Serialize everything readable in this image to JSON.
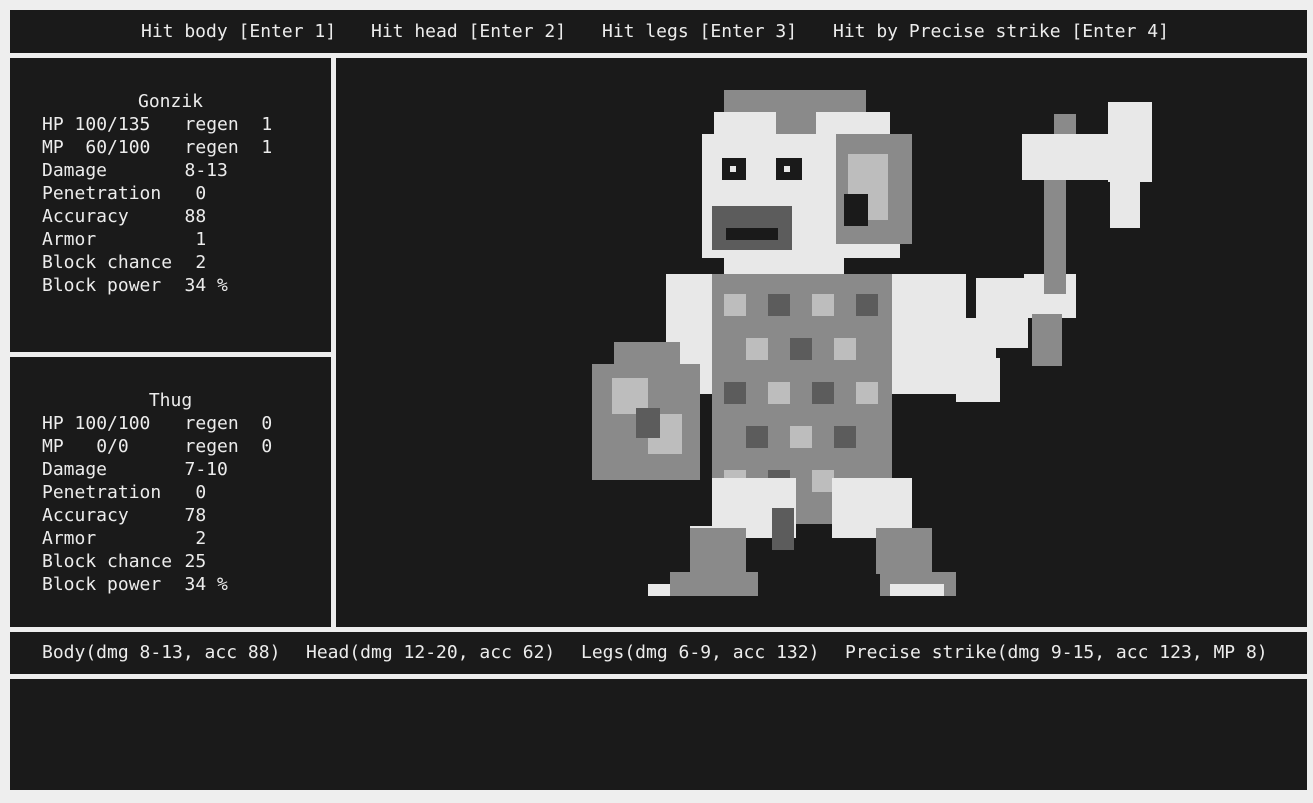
{
  "menu": {
    "items": [
      {
        "label": "Hit body [Enter 1]"
      },
      {
        "label": "Hit head [Enter 2]"
      },
      {
        "label": "Hit legs [Enter 3]"
      },
      {
        "label": "Hit by Precise strike [Enter 4]"
      }
    ]
  },
  "hero": {
    "name": "Gonzik",
    "hp_label": "HP",
    "hp": "100/135",
    "hp_regen_label": "regen",
    "hp_regen": "1",
    "mp_label": "MP",
    "mp": " 60/100",
    "mp_regen_label": "regen",
    "mp_regen": "1",
    "stats": [
      {
        "name": "Damage",
        "value": "   8-13"
      },
      {
        "name": "Penetration",
        "value": "    0"
      },
      {
        "name": "Accuracy",
        "value": "   88"
      },
      {
        "name": "Armor",
        "value": "    1"
      },
      {
        "name": "Block chance",
        "value": "    2"
      },
      {
        "name": "Block power",
        "value": "   34 %"
      }
    ]
  },
  "enemy": {
    "name": "Thug",
    "hp_label": "HP",
    "hp": "100/100",
    "hp_regen_label": "regen",
    "hp_regen": "0",
    "mp_label": "MP",
    "mp": "  0/0",
    "mp_regen_label": "regen",
    "mp_regen": "0",
    "stats": [
      {
        "name": "Damage",
        "value": "   7-10"
      },
      {
        "name": "Penetration",
        "value": "    0"
      },
      {
        "name": "Accuracy",
        "value": "   78"
      },
      {
        "name": "Armor",
        "value": "    2"
      },
      {
        "name": "Block chance",
        "value": "   25"
      },
      {
        "name": "Block power",
        "value": "   34 %"
      }
    ]
  },
  "attacks": [
    {
      "label": "Body(dmg 8-13, acc 88)"
    },
    {
      "label": "Head(dmg 12-20, acc 62)"
    },
    {
      "label": "Legs(dmg 6-9, acc 132)"
    },
    {
      "label": "Precise strike(dmg 9-15, acc 123, MP 8)"
    }
  ],
  "colors": {
    "panel_bg": "#1a1a1a",
    "frame": "#eeeeee",
    "text": "#ececec",
    "sprite_light": "#e8e8e8",
    "sprite_mid": "#bdbdbd",
    "sprite_dark": "#8a8a8a",
    "sprite_deep": "#5c5c5c"
  },
  "sprite": {
    "label": "thug-with-axe-and-shield"
  }
}
